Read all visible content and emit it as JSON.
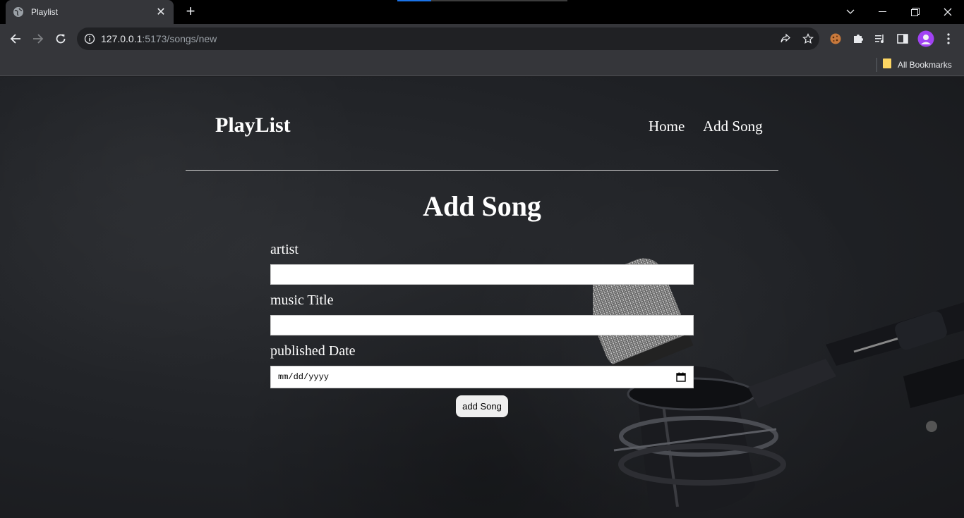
{
  "browser": {
    "tab_title": "Playlist",
    "new_tab_symbol": "+",
    "url_host": "127.0.0.1",
    "url_path": ":5173/songs/new",
    "bookmarks_label": "All Bookmarks",
    "accent_color": "#1a73e8"
  },
  "site": {
    "brand": "PlayList",
    "nav": [
      "Home",
      "Add Song"
    ]
  },
  "form": {
    "title": "Add Song",
    "fields": [
      {
        "label": "artist",
        "value": ""
      },
      {
        "label": "music Title",
        "value": ""
      },
      {
        "label": "published Date",
        "placeholder": "mm/dd/yyyy"
      }
    ],
    "submit_label": "add Song"
  }
}
